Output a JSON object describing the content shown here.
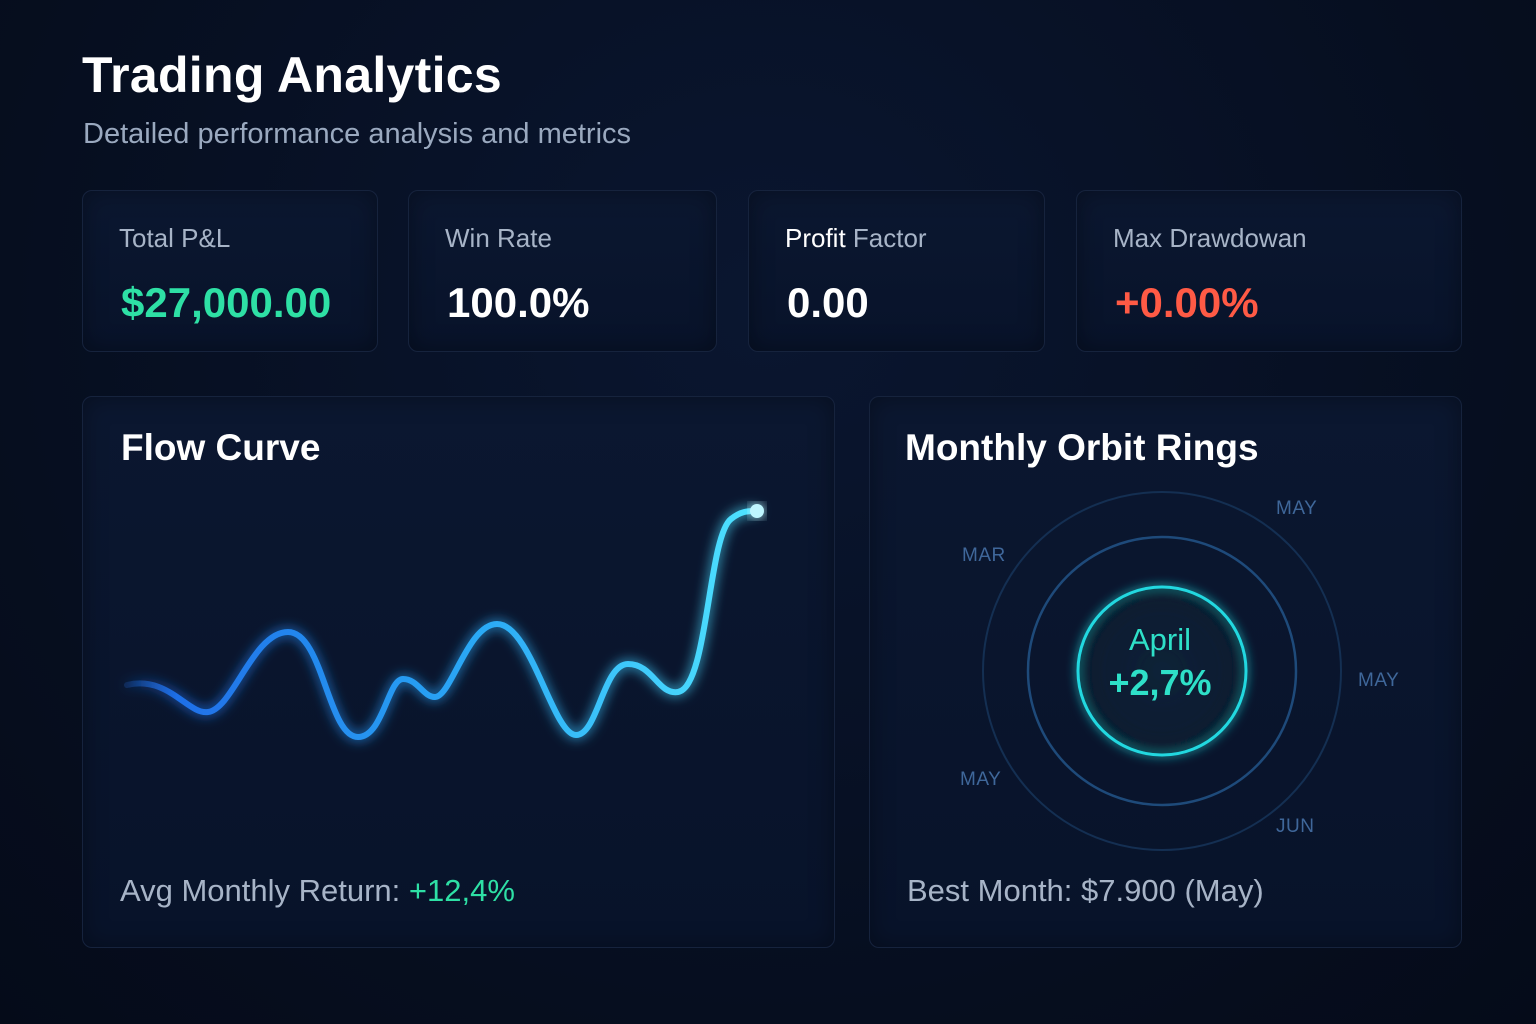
{
  "header": {
    "title": "Trading Analytics",
    "subtitle": "Detailed performance analysis and metrics"
  },
  "stats": [
    {
      "label": "Total P&L",
      "value": "$27,000.00"
    },
    {
      "label": "Win Rate",
      "value": "100.0%"
    },
    {
      "label_strong": "Profit",
      "label_rest": " Factor",
      "value": "0.00"
    },
    {
      "label": "Max Drawdowan",
      "value": "+0.00%"
    }
  ],
  "colors": {
    "positive": "#2ee0a5",
    "negative": "#ff5a45",
    "curve_start": "#1f6fe8",
    "curve_end": "#4fe3ff",
    "ring": "#1e4a7a",
    "ring_inner": "#22d8e0"
  },
  "flow": {
    "title": "Flow Curve",
    "footer_label": "Avg Monthly Return: ",
    "footer_value": "+12,4%"
  },
  "orbit": {
    "title": "Monthly Orbit Rings",
    "month_labels": [
      "MAY",
      "MAR",
      "MAY",
      "MAY",
      "JUN"
    ],
    "center_month": "April",
    "center_value": "+2,7%",
    "footer": "Best Month: $7.900 (May)"
  }
}
